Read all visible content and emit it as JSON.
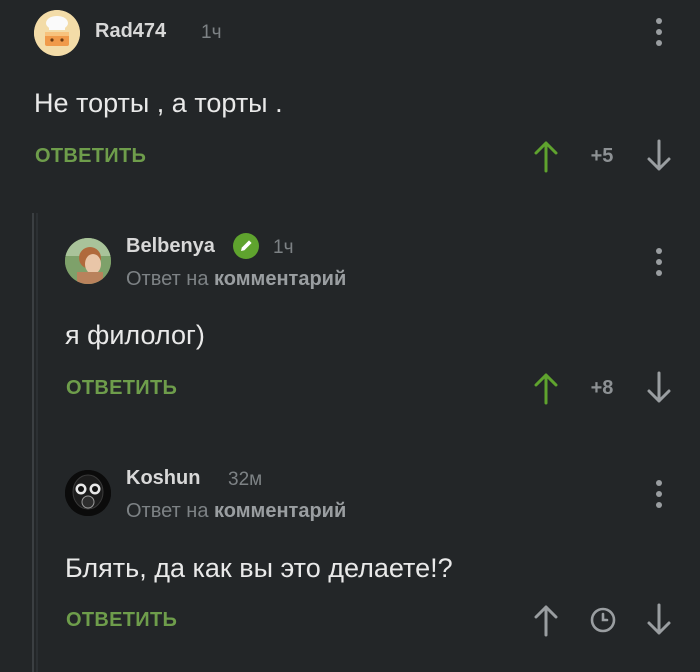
{
  "comments": [
    {
      "username": "Rad474",
      "time": "1ч",
      "text": "Не торты , а торты .",
      "reply_label": "ОТВЕТИТЬ",
      "score": "+5",
      "avatar_icon": "chef-cake-avatar-icon"
    },
    {
      "username": "Belbenya",
      "time": "1ч",
      "reply_to_prefix": "Ответ на",
      "reply_to_target": "комментарий",
      "text": "я филолог)",
      "reply_label": "ОТВЕТИТЬ",
      "score": "+8",
      "badge_icon": "pencil-badge-icon"
    },
    {
      "username": "Koshun",
      "time": "32м",
      "reply_to_prefix": "Ответ на",
      "reply_to_target": "комментарий",
      "text": "Блять, да как вы это делаете!?",
      "reply_label": "ОТВЕТИТЬ",
      "score_icon": "clock-icon",
      "avatar_icon": "gas-mask-avatar-icon"
    }
  ],
  "colors": {
    "background": "#232628",
    "accent_green": "#6e9d4b",
    "badge_green": "#5fa32e",
    "muted_text": "#7d8285"
  }
}
